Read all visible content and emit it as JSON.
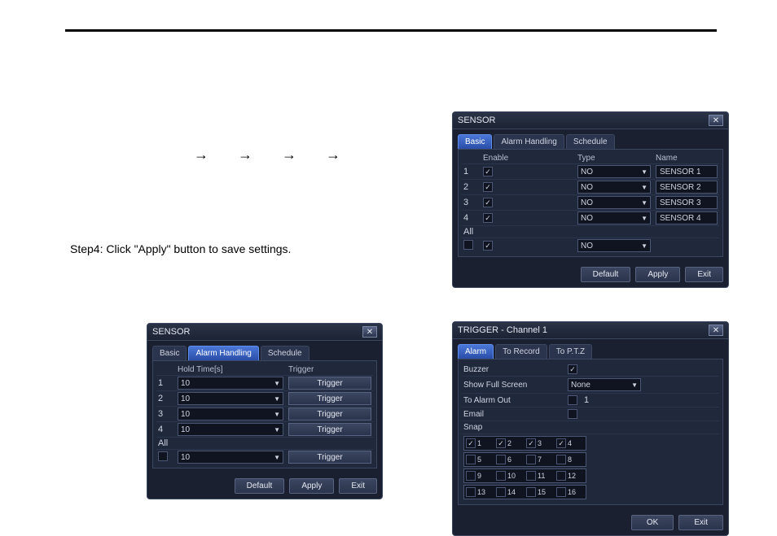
{
  "page": {
    "step_text": "Step4: Click \"Apply\" button to save settings.",
    "arrows": "→→→→"
  },
  "button_labels": {
    "default": "Default",
    "apply": "Apply",
    "exit": "Exit",
    "ok": "OK",
    "trigger": "Trigger"
  },
  "basic": {
    "title": "SENSOR",
    "tabs": {
      "basic": "Basic",
      "alarm": "Alarm Handling",
      "schedule": "Schedule"
    },
    "headers": {
      "enable": "Enable",
      "type": "Type",
      "name": "Name"
    },
    "rows": [
      {
        "idx": "1",
        "type": "NO",
        "name": "SENSOR 1"
      },
      {
        "idx": "2",
        "type": "NO",
        "name": "SENSOR 2"
      },
      {
        "idx": "3",
        "type": "NO",
        "name": "SENSOR 3"
      },
      {
        "idx": "4",
        "type": "NO",
        "name": "SENSOR 4"
      }
    ],
    "all_label": "All",
    "all_type": "NO"
  },
  "alarm": {
    "title": "SENSOR",
    "tabs": {
      "basic": "Basic",
      "alarm": "Alarm Handling",
      "schedule": "Schedule"
    },
    "headers": {
      "hold": "Hold Time[s]",
      "trigger": "Trigger"
    },
    "rows": [
      {
        "idx": "1",
        "hold": "10"
      },
      {
        "idx": "2",
        "hold": "10"
      },
      {
        "idx": "3",
        "hold": "10"
      },
      {
        "idx": "4",
        "hold": "10"
      }
    ],
    "all_label": "All",
    "all_hold": "10"
  },
  "trigger": {
    "title": "TRIGGER - Channel 1",
    "tabs": {
      "alarm": "Alarm",
      "record": "To Record",
      "ptz": "To P.T.Z"
    },
    "labels": {
      "buzzer": "Buzzer",
      "full_screen": "Show Full Screen",
      "alarm_out": "To Alarm Out",
      "email": "Email",
      "snap": "Snap"
    },
    "full_screen_value": "None",
    "alarm_out_value": "1",
    "snap_left": [
      "1",
      "2",
      "3",
      "4"
    ],
    "snap_right_top": [
      "5",
      "6",
      "7",
      "8"
    ],
    "snap_left_bottom": [
      "9",
      "10",
      "11",
      "12"
    ],
    "snap_right_bottom": [
      "13",
      "14",
      "15",
      "16"
    ]
  }
}
